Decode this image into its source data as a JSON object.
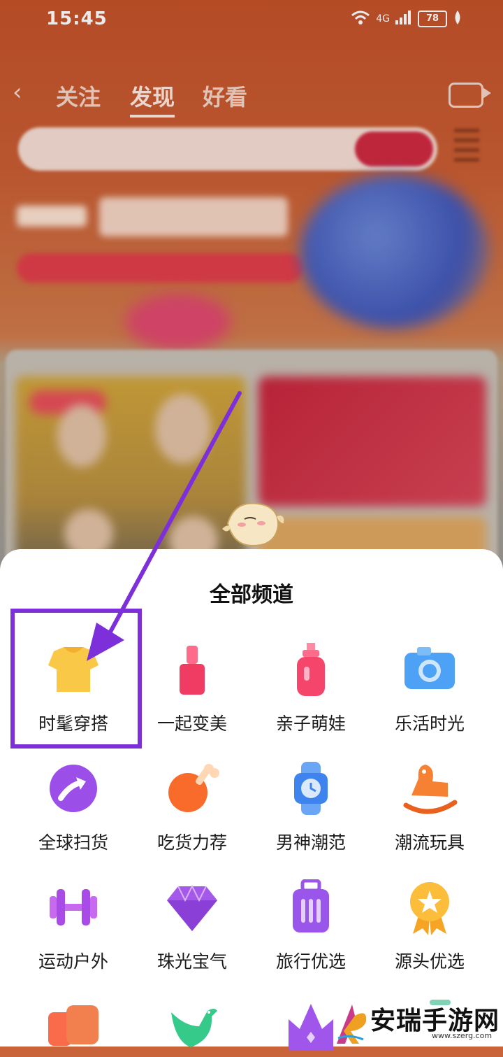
{
  "status_bar": {
    "time": "15:45",
    "network": "4G",
    "battery": "78"
  },
  "top_nav": {
    "tabs": [
      "关注",
      "发现",
      "好看"
    ],
    "active_tab": "发现"
  },
  "sheet": {
    "title": "全部频道",
    "channels": [
      {
        "label": "时髦穿搭",
        "icon": "tshirt-icon"
      },
      {
        "label": "一起变美",
        "icon": "lipstick-icon"
      },
      {
        "label": "亲子萌娃",
        "icon": "baby-bottle-icon"
      },
      {
        "label": "乐活时光",
        "icon": "camera-icon"
      },
      {
        "label": "全球扫货",
        "icon": "arrow-globe-icon"
      },
      {
        "label": "吃货力荐",
        "icon": "drumstick-icon"
      },
      {
        "label": "男神潮范",
        "icon": "watch-icon"
      },
      {
        "label": "潮流玩具",
        "icon": "rocking-horse-icon"
      },
      {
        "label": "运动户外",
        "icon": "dumbbell-icon"
      },
      {
        "label": "珠光宝气",
        "icon": "diamond-icon"
      },
      {
        "label": "旅行优选",
        "icon": "suitcase-icon"
      },
      {
        "label": "源头优选",
        "icon": "medal-icon"
      },
      {
        "label": "",
        "icon": "truck-icon"
      },
      {
        "label": "",
        "icon": "bird-icon"
      },
      {
        "label": "",
        "icon": "crown-icon"
      }
    ]
  },
  "watermark": {
    "text": "安瑞手游网",
    "url": "www.szerg.com"
  },
  "colors": {
    "highlight": "#7d2fd9",
    "header_bg": "#c4522a"
  }
}
